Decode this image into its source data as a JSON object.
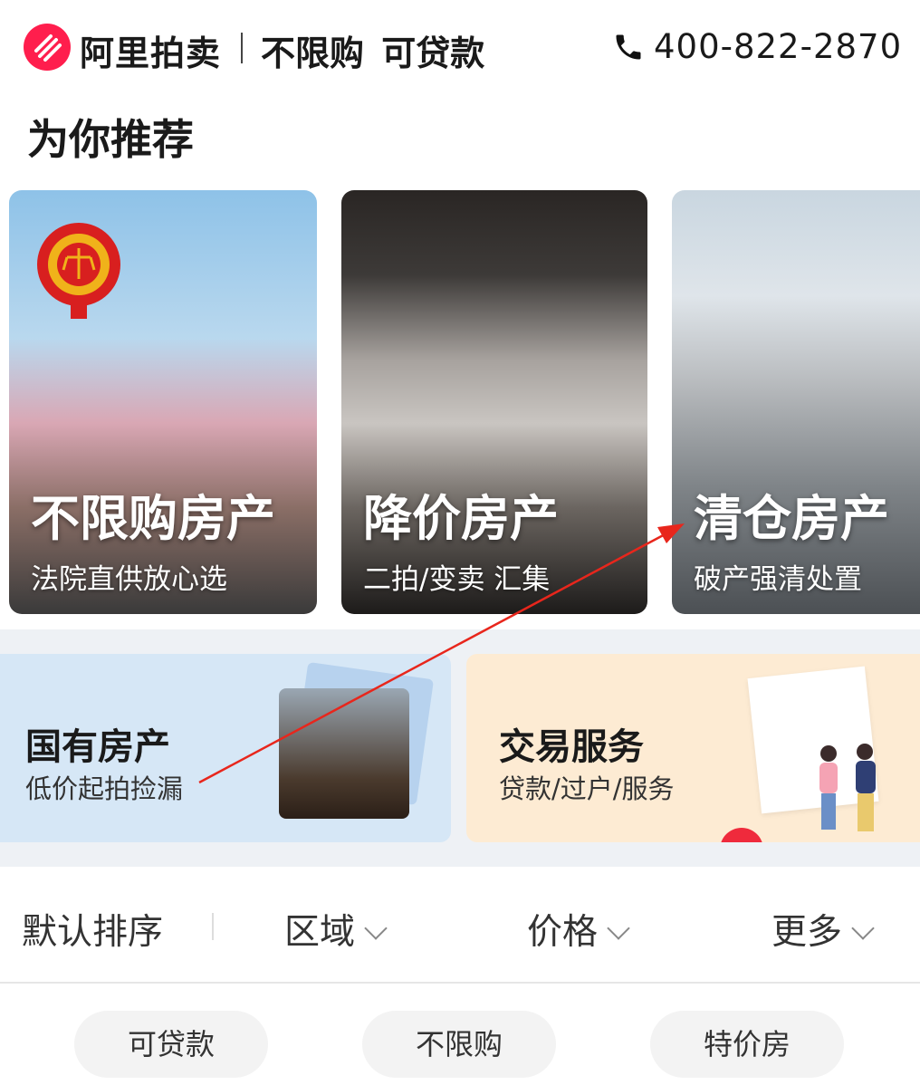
{
  "header": {
    "brand": "阿里拍卖",
    "slogan": "不限购 可贷款",
    "phone": "400-822-2870",
    "phone_icon": "phone-icon",
    "brand_color": "#ff1e4d"
  },
  "section_title": "为你推荐",
  "cards": [
    {
      "title": "不限购房产",
      "subtitle": "法院直供放心选"
    },
    {
      "title": "降价房产",
      "subtitle": "二拍/变卖 汇集"
    },
    {
      "title": "清仓房产",
      "subtitle": "破产强清处置"
    }
  ],
  "banners": [
    {
      "title": "国有房产",
      "subtitle": "低价起拍捡漏"
    },
    {
      "title": "交易服务",
      "subtitle": "贷款/过户/服务"
    }
  ],
  "filters": {
    "sort": "默认排序",
    "area": "区域",
    "price": "价格",
    "more": "更多"
  },
  "tags": [
    "可贷款",
    "不限购",
    "特价房"
  ],
  "annotation_color": "#e8261c"
}
